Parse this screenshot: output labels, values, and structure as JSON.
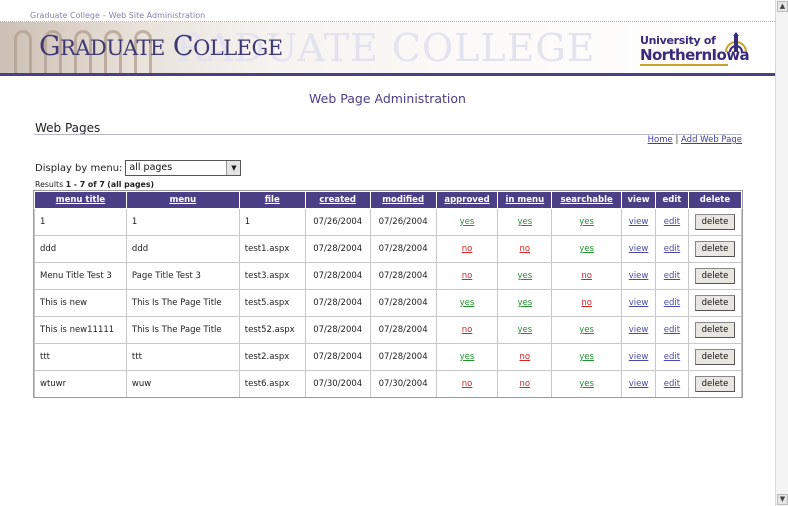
{
  "breadcrumb": {
    "items": [
      "Graduate College",
      "Web Site Administration"
    ],
    "separator": "-"
  },
  "banner": {
    "title_first": "G",
    "title_rest": "RADUATE",
    "title_first2": "C",
    "title_rest2": "OLLEGE",
    "ghost_text": "RADUATE COLLEGE",
    "university_top": "University of",
    "university_bottom": "NorthernIowa"
  },
  "page_title": "Web Page Administration",
  "section_title": "Web Pages",
  "toplinks": {
    "home": "Home",
    "separator": "|",
    "add": "Add Web Page"
  },
  "filter": {
    "label": "Display by menu:",
    "selected": "all pages"
  },
  "results": {
    "prefix": "Results",
    "range": "1 - 7 of 7",
    "scope": "(all pages)"
  },
  "table": {
    "headers": [
      "menu title",
      "menu",
      "file",
      "created",
      "modified",
      "approved",
      "in menu",
      "searchable",
      "view",
      "edit",
      "delete"
    ],
    "rows": [
      {
        "menu_title": "1",
        "menu": "1",
        "file": "1",
        "created": "07/26/2004",
        "modified": "07/26/2004",
        "approved": "yes",
        "in_menu": "yes",
        "searchable": "yes",
        "view": "view",
        "edit": "edit",
        "delete": "delete"
      },
      {
        "menu_title": "ddd",
        "menu": "ddd",
        "file": "test1.aspx",
        "created": "07/28/2004",
        "modified": "07/28/2004",
        "approved": "no",
        "in_menu": "no",
        "searchable": "yes",
        "view": "view",
        "edit": "edit",
        "delete": "delete"
      },
      {
        "menu_title": "Menu Title Test 3",
        "menu": "Page Title Test 3",
        "file": "test3.aspx",
        "created": "07/28/2004",
        "modified": "07/28/2004",
        "approved": "no",
        "in_menu": "yes",
        "searchable": "no",
        "view": "view",
        "edit": "edit",
        "delete": "delete"
      },
      {
        "menu_title": "This is new",
        "menu": "This Is The Page Title",
        "file": "test5.aspx",
        "created": "07/28/2004",
        "modified": "07/28/2004",
        "approved": "yes",
        "in_menu": "yes",
        "searchable": "no",
        "view": "view",
        "edit": "edit",
        "delete": "delete"
      },
      {
        "menu_title": "This is new11111",
        "menu": "This Is The Page Title",
        "file": "test52.aspx",
        "created": "07/28/2004",
        "modified": "07/28/2004",
        "approved": "no",
        "in_menu": "yes",
        "searchable": "yes",
        "view": "view",
        "edit": "edit",
        "delete": "delete"
      },
      {
        "menu_title": "ttt",
        "menu": "ttt",
        "file": "test2.aspx",
        "created": "07/28/2004",
        "modified": "07/28/2004",
        "approved": "yes",
        "in_menu": "no",
        "searchable": "yes",
        "view": "view",
        "edit": "edit",
        "delete": "delete"
      },
      {
        "menu_title": "wtuwr",
        "menu": "wuw",
        "file": "test6.aspx",
        "created": "07/30/2004",
        "modified": "07/30/2004",
        "approved": "no",
        "in_menu": "no",
        "searchable": "yes",
        "view": "view",
        "edit": "edit",
        "delete": "delete"
      }
    ]
  },
  "colors": {
    "accent_purple": "#4b3f86",
    "yes_green": "#22922f",
    "no_red": "#d12424",
    "link_blue": "#3b3f9e",
    "logo_gold": "#c9a227"
  },
  "icons": {
    "scroll_up": "triangle-up-icon",
    "scroll_down": "triangle-down-icon",
    "select_arrow": "chevron-down-icon",
    "university_mark": "campanile-logo-icon"
  }
}
